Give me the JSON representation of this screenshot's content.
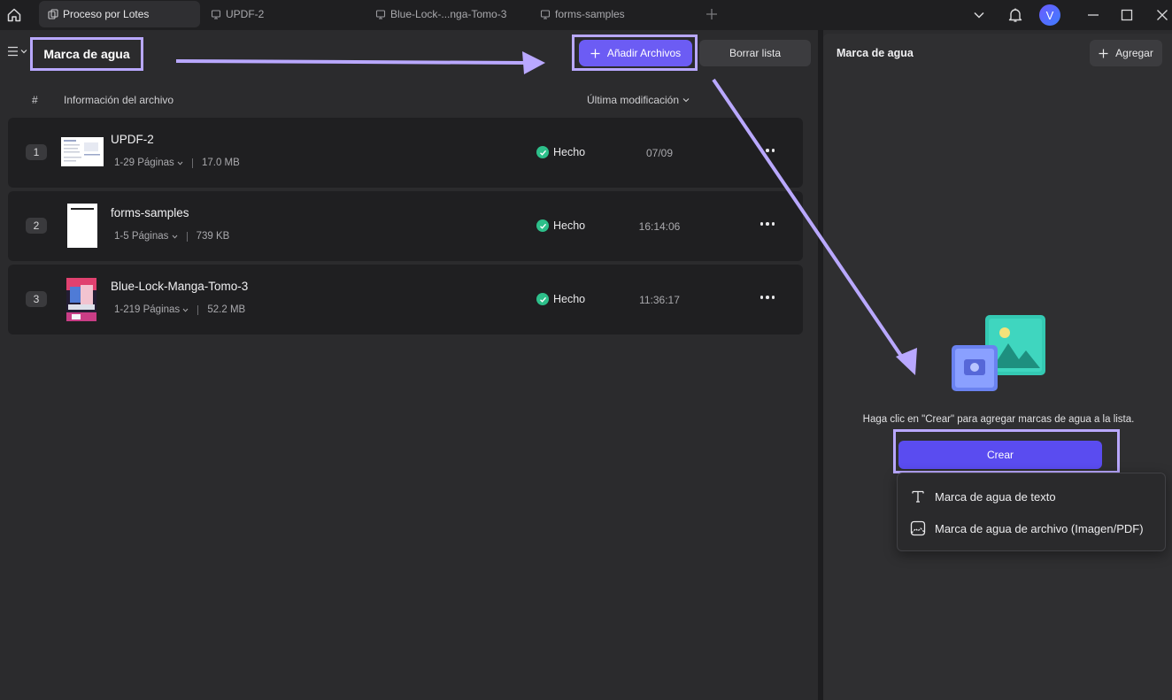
{
  "titlebar": {
    "tabs": [
      {
        "label": "Proceso por Lotes",
        "icon": "batch-icon",
        "active": true
      },
      {
        "label": "UPDF-2",
        "icon": "document-icon",
        "active": false
      },
      {
        "label": "Blue-Lock-...nga-Tomo-3",
        "icon": "document-icon",
        "active": false
      },
      {
        "label": "forms-samples",
        "icon": "document-icon",
        "active": false
      }
    ],
    "avatar_letter": "V"
  },
  "left": {
    "title": "Marca de agua",
    "add_files_label": "Añadir Archivos",
    "clear_list_label": "Borrar lista",
    "columns": {
      "number": "#",
      "info": "Información del archivo",
      "modified": "Última modificación"
    },
    "files": [
      {
        "index": "1",
        "name": "UPDF-2",
        "pages": "1-29 Páginas",
        "size": "17.0 MB",
        "status": "Hecho",
        "modified": "07/09"
      },
      {
        "index": "2",
        "name": "forms-samples",
        "pages": "1-5 Páginas",
        "size": "739 KB",
        "status": "Hecho",
        "modified": "16:14:06"
      },
      {
        "index": "3",
        "name": "Blue-Lock-Manga-Tomo-3",
        "pages": "1-219 Páginas",
        "size": "52.2 MB",
        "status": "Hecho",
        "modified": "11:36:17"
      }
    ]
  },
  "right": {
    "title": "Marca de agua",
    "add_label": "Agregar",
    "hint": "Haga clic en \"Crear\" para agregar marcas de agua a la lista.",
    "create_label": "Crear",
    "menu": [
      {
        "label": "Marca de agua de texto",
        "icon": "text-icon"
      },
      {
        "label": "Marca de agua de archivo (Imagen/PDF)",
        "icon": "image-file-icon"
      }
    ]
  },
  "colors": {
    "accent": "#6c5cf4",
    "annotation": "#b9a8ff",
    "success": "#2dbf8a"
  }
}
